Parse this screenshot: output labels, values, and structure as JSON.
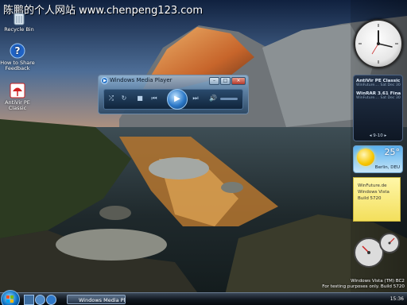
{
  "watermark": "陈鹏的个人网站  www.chenpeng123.com",
  "desktop_icons": [
    {
      "label": "Recycle Bin"
    },
    {
      "label": "How to Share Feedback"
    },
    {
      "label": "AntiVir PE Classic"
    }
  ],
  "media_player": {
    "title": "Windows Media Player",
    "controls": {
      "minimize": "–",
      "maximize": "□",
      "close": "×"
    }
  },
  "sidebar": {
    "feeds": [
      {
        "title": "AntiVir PE Classic 7...",
        "sub": "WinFuture.... Sat Dec 30"
      },
      {
        "title": "WinRAR 3.61 Final -...",
        "sub": "WinFuture.... Sat Dec 30"
      }
    ],
    "feed_nav": "9-10",
    "weather": {
      "temp": "25°",
      "city": "Berlin, DEU"
    },
    "note_lines": [
      "WinFuture.de",
      "Windows Vista",
      "Build 5720"
    ]
  },
  "os_info": {
    "line1": "Windows Vista (TM) BC2",
    "line2": "For testing purposes only. Build 5720"
  },
  "taskbar": {
    "task_label": "Windows Media Pla...",
    "clock": "15:36"
  }
}
